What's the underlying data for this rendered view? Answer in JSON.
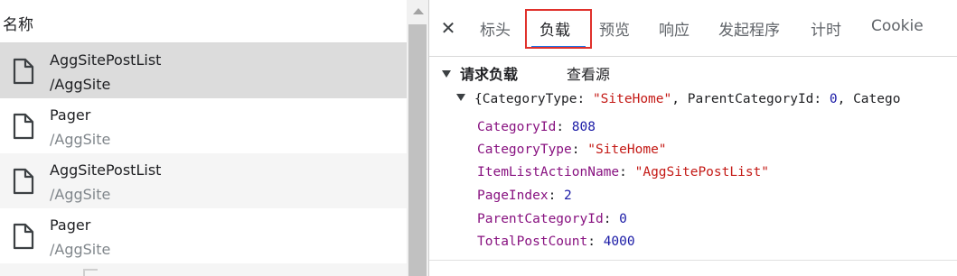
{
  "network_list": {
    "header": "名称",
    "rows": [
      {
        "name": "AggSitePostList",
        "path": "/AggSite",
        "state": "selected"
      },
      {
        "name": "Pager",
        "path": "/AggSite",
        "state": "plain"
      },
      {
        "name": "AggSitePostList",
        "path": "/AggSite",
        "state": "alt"
      },
      {
        "name": "Pager",
        "path": "/AggSite",
        "state": "plain"
      }
    ]
  },
  "details": {
    "close_glyph": "✕",
    "tabs": [
      {
        "label": "标头",
        "active": false
      },
      {
        "label": "负载",
        "active": true
      },
      {
        "label": "预览",
        "active": false
      },
      {
        "label": "响应",
        "active": false
      },
      {
        "label": "发起程序",
        "active": false
      },
      {
        "label": "计时",
        "active": false
      },
      {
        "label": "Cookie",
        "active": false
      }
    ],
    "highlight_color": "#e0312c",
    "active_underline_color": "#1a73e8",
    "payload": {
      "section_title": "请求负载",
      "view_source": "查看源",
      "summary": {
        "open": "{CategoryType: ",
        "cat_type": "\"SiteHome\"",
        "mid": ", ParentCategoryId: ",
        "parent_id": "0",
        "tail": ", Catego"
      },
      "properties": [
        {
          "key": "CategoryId",
          "value": "808",
          "kind": "num"
        },
        {
          "key": "CategoryType",
          "value": "\"SiteHome\"",
          "kind": "str"
        },
        {
          "key": "ItemListActionName",
          "value": "\"AggSitePostList\"",
          "kind": "str"
        },
        {
          "key": "PageIndex",
          "value": "2",
          "kind": "num"
        },
        {
          "key": "ParentCategoryId",
          "value": "0",
          "kind": "num"
        },
        {
          "key": "TotalPostCount",
          "value": "4000",
          "kind": "num"
        }
      ]
    }
  }
}
